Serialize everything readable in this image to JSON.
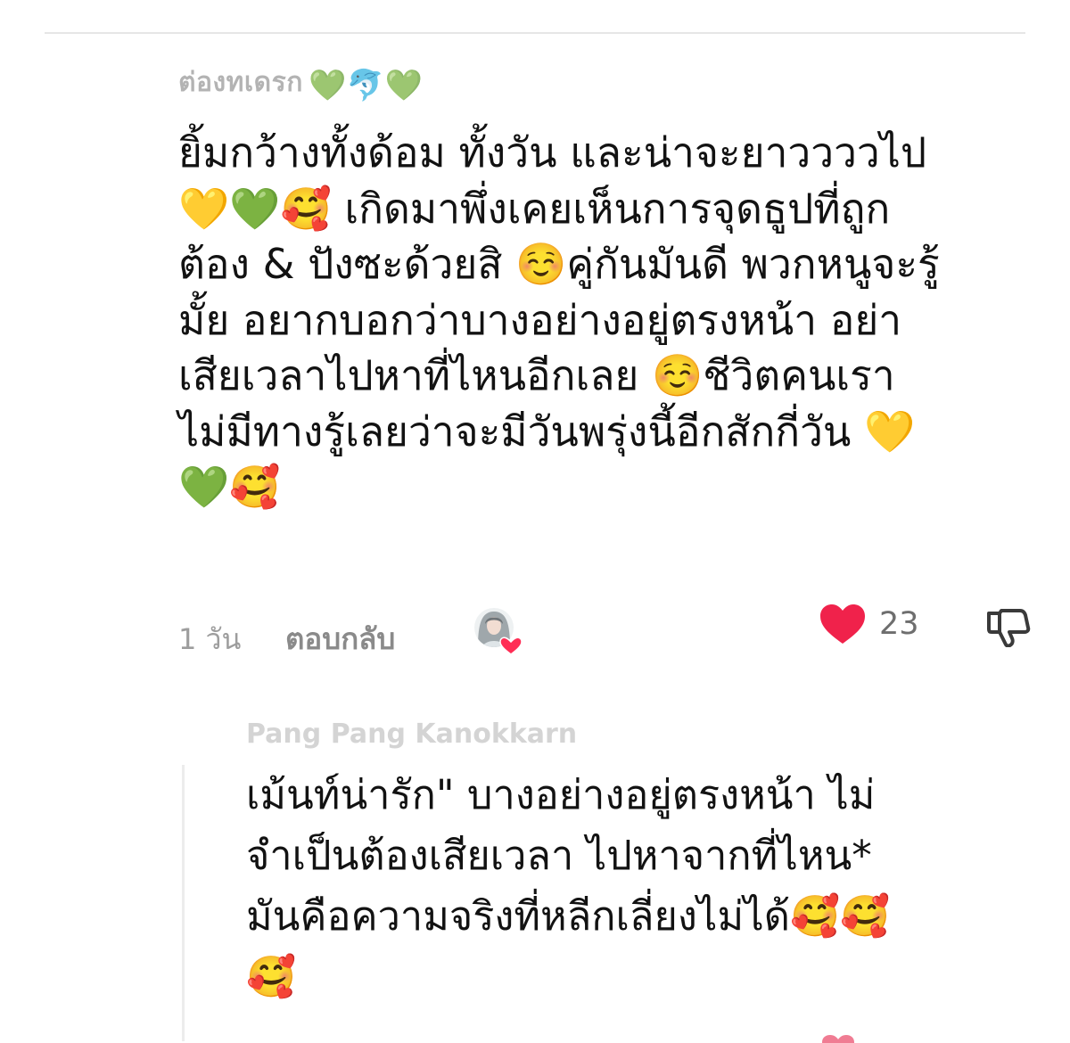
{
  "main_comment": {
    "username": "ต่องทเดรก",
    "username_emojis": "💚🐬💚",
    "lines": [
      "ยิ้มกว้างทั้งด้อม ทั้งวัน และน่าจะยาววววไป",
      "💛💚🥰 เกิดมาพึ่งเคยเห็นการจุดธูปที่ถูก",
      "ต้อง & ปังซะด้วยสิ ☺️คู่กันมันดี พวกหนูจะรู้",
      "มั้ย อยากบอกว่าบางอย่างอยู่ตรงหน้า อย่า",
      "เสียเวลาไปหาที่ไหนอีกเลย ☺️ชีวิตคนเรา",
      "ไม่มีทางรู้เลยว่าจะมีวันพรุ่งนี้อีกสักกี่วัน 💛",
      "💚🥰"
    ],
    "timestamp": "1 วัน",
    "reply_label": "ตอบกลับ",
    "like_count": "23",
    "icons": {
      "like": "heart-icon",
      "dislike": "thumbs-down-icon",
      "creator": "creator-liked-avatar"
    },
    "colors": {
      "like_heart": "#f0224b",
      "creator_heart": "#ff2d55"
    }
  },
  "reply": {
    "username": "Pang Pang Kanokkarn",
    "lines": [
      "เม้นท์น่ารัก\" บางอย่างอยู่ตรงหน้า ไม่",
      "จำเป็นต้องเสียเวลา ไปหาจากที่ไหน*",
      "มันคือความจริงที่หลีกเลี่ยงไม่ได้🥰🥰",
      "🥰"
    ]
  }
}
